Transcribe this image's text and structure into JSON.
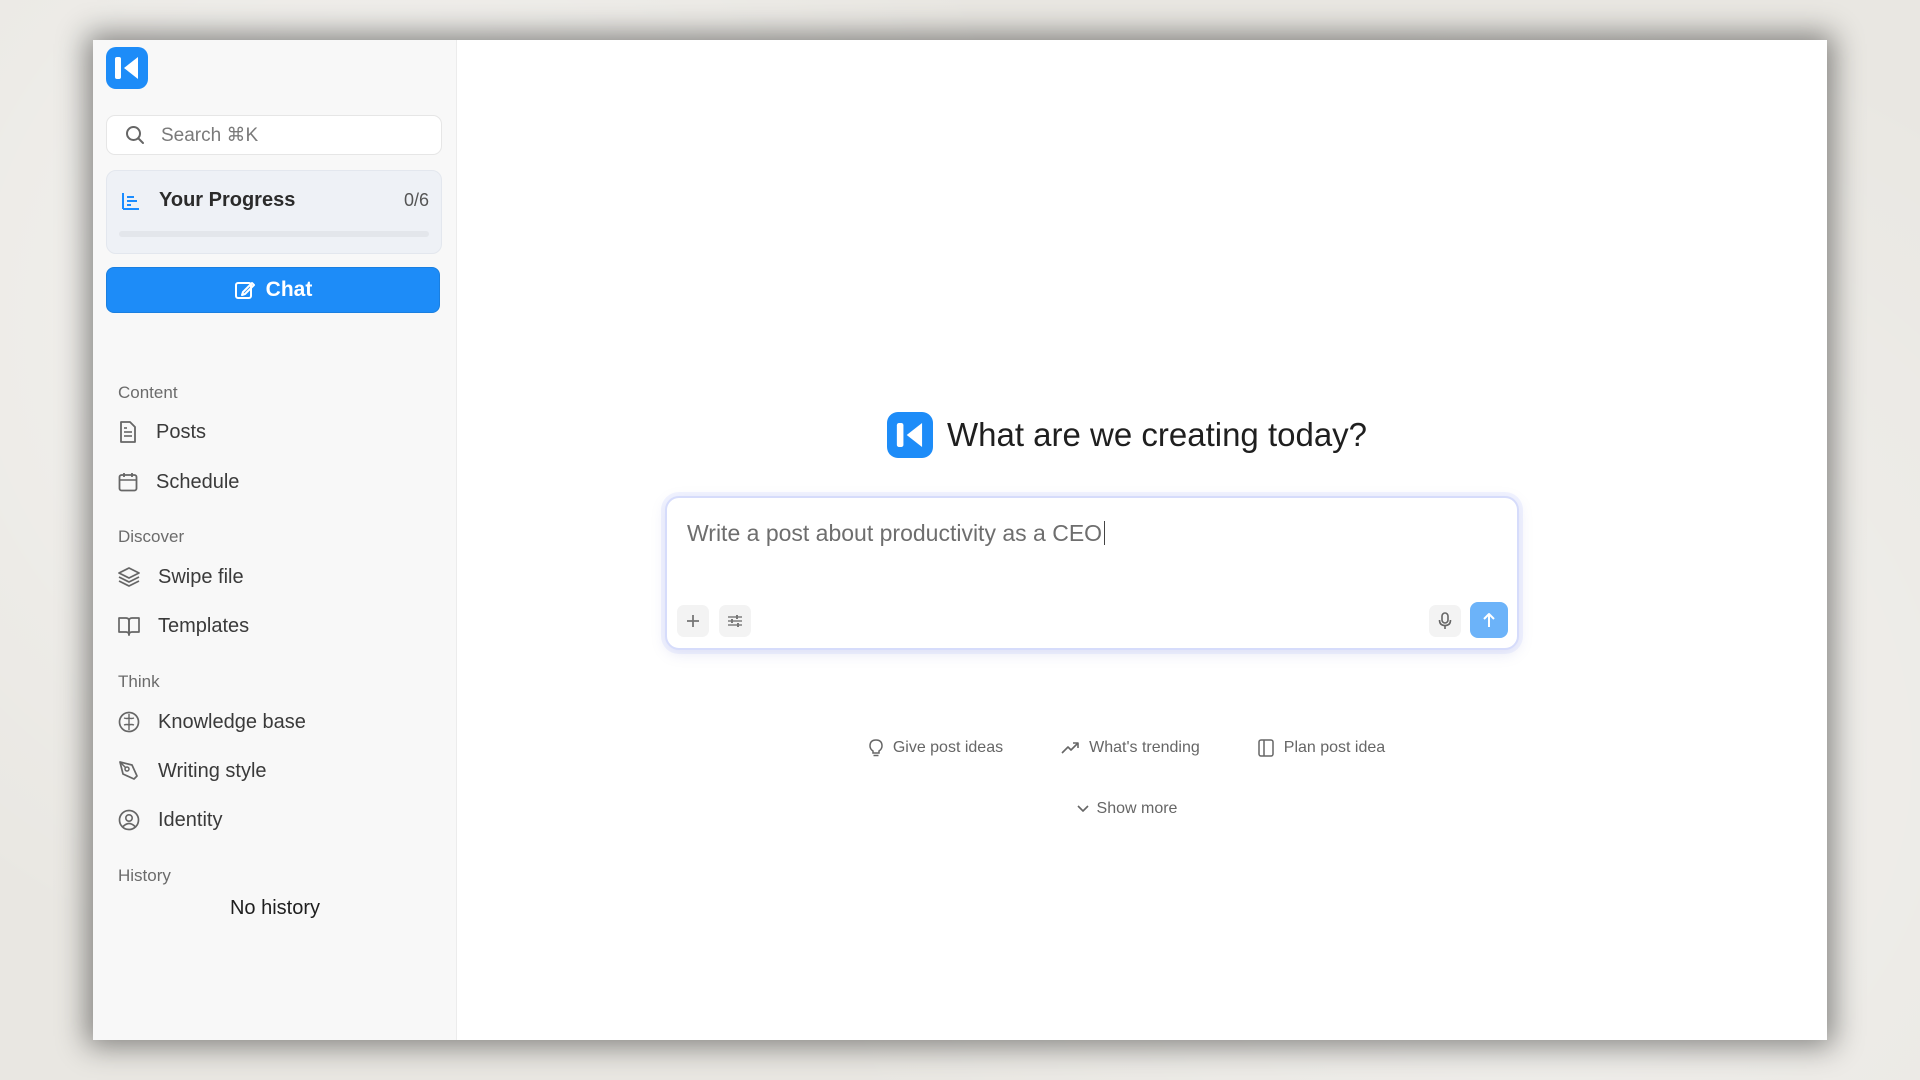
{
  "sidebar": {
    "search_placeholder": "Search ⌘K",
    "progress": {
      "label": "Your Progress",
      "count": "0/6",
      "fraction": 0
    },
    "chat_button": "Chat",
    "sections": [
      {
        "title": "Content",
        "items": [
          "Posts",
          "Schedule"
        ]
      },
      {
        "title": "Discover",
        "items": [
          "Swipe file",
          "Templates"
        ]
      },
      {
        "title": "Think",
        "items": [
          "Knowledge base",
          "Writing style",
          "Identity"
        ]
      },
      {
        "title": "History",
        "items": []
      }
    ],
    "history_empty": "No history"
  },
  "main": {
    "heading": "What are we creating today?",
    "composer_text": "Write a post about productivity as a CEO",
    "suggestions": [
      "Give post ideas",
      "What's trending",
      "Plan post idea"
    ],
    "show_more": "Show more"
  },
  "colors": {
    "accent": "#1d8cf8",
    "send_button": "#6cb3f9"
  }
}
